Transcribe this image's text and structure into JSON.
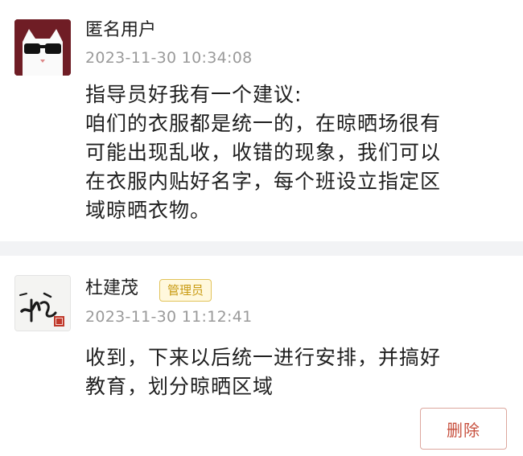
{
  "comments": [
    {
      "author": "匿名用户",
      "timestamp": "2023-11-30 10:34:08",
      "avatar_icon": "cat-sunglasses-avatar",
      "avatar_color": "#6f1d25",
      "content_lines": [
        "指导员好我有一个建议:",
        "咱们的衣服都是统一的，在晾晒场很有",
        "可能出现乱收，收错的现象，我们可以",
        "在衣服内贴好名字，每个班设立指定区",
        "域晾晒衣物。"
      ]
    },
    {
      "author": "杜建茂",
      "badge": "管理员",
      "timestamp": "2023-11-30 11:12:41",
      "avatar_icon": "calligraphy-signature-avatar",
      "content_lines": [
        "收到，下来以后统一进行安排，并搞好",
        "教育，划分晾晒区域"
      ],
      "delete_label": "删除"
    }
  ],
  "colors": {
    "badge_text": "#c89a12",
    "badge_bg": "#fff8dd",
    "delete_text": "#c7503e",
    "timestamp": "#9a9a9a",
    "divider": "#f2f3f5"
  }
}
